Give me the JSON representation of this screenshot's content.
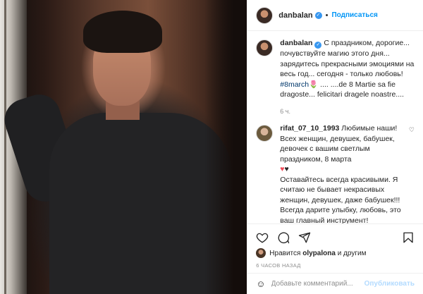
{
  "header": {
    "username": "danbalan",
    "dot": "•",
    "follow_label": "Подписаться"
  },
  "caption": {
    "username": "danbalan",
    "text_1": "С праздником, дорогие... почувствуйте магию этого дня... зарядитесь прекрасными эмоциями на весь год... сегодня - только любовь!",
    "hashtag": "#8march",
    "emoji": "🌷",
    "text_2": ".... ....de 8 Martie sa fie dragoste... felicitari dragele noastre....",
    "time": "6 ч."
  },
  "comment": {
    "username": "rifat_07_10_1993",
    "text_1": "Любимые наши! Всех женщин, девушек, бабушек, девочек с вашим светлым праздником, 8 марта",
    "hearts_1": "♥",
    "hearts_2": "♥",
    "text_2": "Оставайтесь всегда красивыми. Я считаю не бывает некрасивых женщин, девушек, даже бабушек!!! Всегда дарите улыбку, любовь, это ваш",
    "text_3": "главный инструмент!"
  },
  "actions": {
    "liked_by_prefix": "Нравится",
    "liked_by_user": "olypalona",
    "liked_by_suffix": "и другим",
    "timestamp": "6 часов назад"
  },
  "add_comment": {
    "placeholder": "Добавьте комментарий...",
    "publish_label": "Опубликовать"
  },
  "icons": {
    "like": "heart-icon",
    "comment": "comment-icon",
    "share": "paper-plane-icon",
    "save": "bookmark-icon",
    "emoji": "smiley-icon",
    "verified": "verified-badge-icon",
    "comment_like": "small-heart-icon"
  },
  "colors": {
    "accent": "#0095f6",
    "verified": "#3897f0",
    "text": "#262626",
    "muted": "#8e8e8e"
  }
}
